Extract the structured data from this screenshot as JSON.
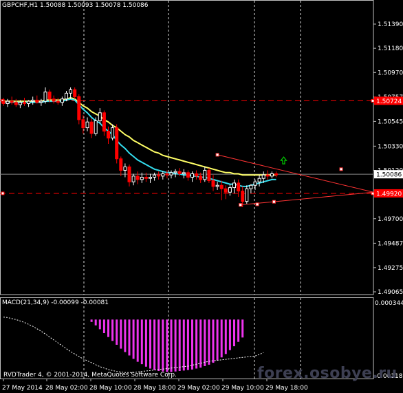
{
  "header": {
    "symbol": "GBPCHF,H1",
    "ohlc": "1.50088 1.50093 1.50078 1.50086"
  },
  "macd_label": "MACD(21,34,9) -0.00099 -0.00081",
  "copyright": "RVDTrader 4, © 2001-2014, MetaQuotes Software Corp.",
  "watermark": "forex.osobye.ru",
  "colors": {
    "background": "#000000",
    "bull_candle": "#ffffff",
    "bear_candle": "#ff0000",
    "ma_slow": "#ffff66",
    "ma_fast": "#33ddee",
    "macd_hist": "#ee33ee",
    "signal_line": "#ffffff",
    "hline": "#ff0000",
    "triangle": "#ff3333",
    "arrow": "#00cc00",
    "grid": "#ffffff"
  },
  "chart_data": {
    "type": "candlestick",
    "price_axis": {
      "ticks": [
        "1.51390",
        "1.51180",
        "1.50970",
        "1.50757",
        "1.50545",
        "1.50330",
        "1.50120",
        "1.49910",
        "1.49700",
        "1.49487",
        "1.49275",
        "1.49065"
      ],
      "current_price": "1.50086",
      "level_high": "1.50724",
      "level_low": "1.49920"
    },
    "time_labels": [
      "27 May 2014",
      "28 May 02:00",
      "28 May 10:00",
      "28 May 18:00",
      "29 May 02:00",
      "29 May 10:00",
      "29 May 18:00"
    ],
    "candles": [
      {
        "o": 1.5072,
        "h": 1.5075,
        "l": 1.5068,
        "c": 1.507
      },
      {
        "o": 1.507,
        "h": 1.5074,
        "l": 1.5067,
        "c": 1.5072
      },
      {
        "o": 1.5072,
        "h": 1.5076,
        "l": 1.5069,
        "c": 1.5071
      },
      {
        "o": 1.5071,
        "h": 1.5074,
        "l": 1.5067,
        "c": 1.5069
      },
      {
        "o": 1.5069,
        "h": 1.5073,
        "l": 1.5066,
        "c": 1.5071
      },
      {
        "o": 1.5071,
        "h": 1.5075,
        "l": 1.5068,
        "c": 1.507
      },
      {
        "o": 1.507,
        "h": 1.5073,
        "l": 1.5067,
        "c": 1.5072
      },
      {
        "o": 1.5072,
        "h": 1.5076,
        "l": 1.5069,
        "c": 1.5073
      },
      {
        "o": 1.5073,
        "h": 1.5077,
        "l": 1.507,
        "c": 1.5071
      },
      {
        "o": 1.5071,
        "h": 1.5074,
        "l": 1.5068,
        "c": 1.5072
      },
      {
        "o": 1.5072,
        "h": 1.5084,
        "l": 1.507,
        "c": 1.508
      },
      {
        "o": 1.508,
        "h": 1.5082,
        "l": 1.5071,
        "c": 1.5074
      },
      {
        "o": 1.5074,
        "h": 1.5077,
        "l": 1.507,
        "c": 1.5072
      },
      {
        "o": 1.5072,
        "h": 1.5075,
        "l": 1.5069,
        "c": 1.5071
      },
      {
        "o": 1.5071,
        "h": 1.5076,
        "l": 1.5068,
        "c": 1.5074
      },
      {
        "o": 1.5074,
        "h": 1.5081,
        "l": 1.5072,
        "c": 1.5079
      },
      {
        "o": 1.5079,
        "h": 1.5084,
        "l": 1.5074,
        "c": 1.5082
      },
      {
        "o": 1.5082,
        "h": 1.5084,
        "l": 1.5074,
        "c": 1.5076
      },
      {
        "o": 1.5076,
        "h": 1.5078,
        "l": 1.5052,
        "c": 1.5056
      },
      {
        "o": 1.5056,
        "h": 1.506,
        "l": 1.5044,
        "c": 1.5049
      },
      {
        "o": 1.5049,
        "h": 1.5058,
        "l": 1.5046,
        "c": 1.5054
      },
      {
        "o": 1.5054,
        "h": 1.5057,
        "l": 1.504,
        "c": 1.5044
      },
      {
        "o": 1.5044,
        "h": 1.5058,
        "l": 1.5042,
        "c": 1.5055
      },
      {
        "o": 1.5055,
        "h": 1.5066,
        "l": 1.5053,
        "c": 1.5062
      },
      {
        "o": 1.5062,
        "h": 1.5064,
        "l": 1.5042,
        "c": 1.5046
      },
      {
        "o": 1.5046,
        "h": 1.505,
        "l": 1.5035,
        "c": 1.504
      },
      {
        "o": 1.504,
        "h": 1.5052,
        "l": 1.5038,
        "c": 1.5049
      },
      {
        "o": 1.5049,
        "h": 1.5052,
        "l": 1.5018,
        "c": 1.5022
      },
      {
        "o": 1.5022,
        "h": 1.5024,
        "l": 1.5007,
        "c": 1.5012
      },
      {
        "o": 1.5012,
        "h": 1.5018,
        "l": 1.5006,
        "c": 1.5015
      },
      {
        "o": 1.5015,
        "h": 1.5017,
        "l": 1.4998,
        "c": 1.5002
      },
      {
        "o": 1.5002,
        "h": 1.5009,
        "l": 1.4999,
        "c": 1.5007
      },
      {
        "o": 1.5007,
        "h": 1.5011,
        "l": 1.5,
        "c": 1.5004
      },
      {
        "o": 1.5004,
        "h": 1.501,
        "l": 1.5001,
        "c": 1.5006
      },
      {
        "o": 1.5006,
        "h": 1.501,
        "l": 1.5002,
        "c": 1.5005
      },
      {
        "o": 1.5005,
        "h": 1.5009,
        "l": 1.5001,
        "c": 1.5006
      },
      {
        "o": 1.5006,
        "h": 1.501,
        "l": 1.5003,
        "c": 1.5008
      },
      {
        "o": 1.5008,
        "h": 1.5011,
        "l": 1.5004,
        "c": 1.5007
      },
      {
        "o": 1.5007,
        "h": 1.5011,
        "l": 1.5004,
        "c": 1.5009
      },
      {
        "o": 1.5009,
        "h": 1.5012,
        "l": 1.5005,
        "c": 1.5008
      },
      {
        "o": 1.5008,
        "h": 1.5012,
        "l": 1.5005,
        "c": 1.501
      },
      {
        "o": 1.501,
        "h": 1.5013,
        "l": 1.5006,
        "c": 1.5011
      },
      {
        "o": 1.5011,
        "h": 1.5014,
        "l": 1.5007,
        "c": 1.5009
      },
      {
        "o": 1.5009,
        "h": 1.5013,
        "l": 1.5005,
        "c": 1.501
      },
      {
        "o": 1.501,
        "h": 1.5012,
        "l": 1.5003,
        "c": 1.5006
      },
      {
        "o": 1.5006,
        "h": 1.5011,
        "l": 1.5002,
        "c": 1.5009
      },
      {
        "o": 1.5009,
        "h": 1.5012,
        "l": 1.5004,
        "c": 1.5007
      },
      {
        "o": 1.5007,
        "h": 1.501,
        "l": 1.5001,
        "c": 1.5004
      },
      {
        "o": 1.5004,
        "h": 1.5015,
        "l": 1.5002,
        "c": 1.5012
      },
      {
        "o": 1.5012,
        "h": 1.5014,
        "l": 1.5001,
        "c": 1.5003
      },
      {
        "o": 1.5003,
        "h": 1.5008,
        "l": 1.4994,
        "c": 1.4998
      },
      {
        "o": 1.4998,
        "h": 1.5002,
        "l": 1.4995,
        "c": 1.4999
      },
      {
        "o": 1.4999,
        "h": 1.5003,
        "l": 1.4986,
        "c": 1.4996
      },
      {
        "o": 1.4996,
        "h": 1.4999,
        "l": 1.4987,
        "c": 1.4993
      },
      {
        "o": 1.4993,
        "h": 1.5,
        "l": 1.499,
        "c": 1.4997
      },
      {
        "o": 1.4997,
        "h": 1.5004,
        "l": 1.4992,
        "c": 1.5001
      },
      {
        "o": 1.5001,
        "h": 1.5004,
        "l": 1.4989,
        "c": 1.4994
      },
      {
        "o": 1.4994,
        "h": 1.4998,
        "l": 1.498,
        "c": 1.4985
      },
      {
        "o": 1.4985,
        "h": 1.4999,
        "l": 1.4983,
        "c": 1.4996
      },
      {
        "o": 1.4996,
        "h": 1.5,
        "l": 1.4992,
        "c": 1.4999
      },
      {
        "o": 1.4999,
        "h": 1.5004,
        "l": 1.4995,
        "c": 1.5002
      },
      {
        "o": 1.5002,
        "h": 1.5008,
        "l": 1.4998,
        "c": 1.5005
      },
      {
        "o": 1.5005,
        "h": 1.5011,
        "l": 1.5001,
        "c": 1.5008
      },
      {
        "o": 1.5008,
        "h": 1.5012,
        "l": 1.5004,
        "c": 1.5007
      },
      {
        "o": 1.5007,
        "h": 1.5011,
        "l": 1.5005,
        "c": 1.5009
      },
      {
        "o": 1.5009,
        "h": 1.5011,
        "l": 1.5006,
        "c": 1.5008
      }
    ],
    "ma_slow": [
      1.5072,
      1.5072,
      1.5072,
      1.5072,
      1.5072,
      1.5072,
      1.5072,
      1.5072,
      1.5072,
      1.5072,
      1.5073,
      1.5073,
      1.5073,
      1.5073,
      1.5073,
      1.5074,
      1.5075,
      1.5074,
      1.5071,
      1.5068,
      1.5066,
      1.5063,
      1.5061,
      1.5059,
      1.5056,
      1.5054,
      1.5051,
      1.5049,
      1.5046,
      1.5043,
      1.5041,
      1.5038,
      1.5036,
      1.5034,
      1.5032,
      1.503,
      1.5028,
      1.5027,
      1.5025,
      1.5024,
      1.5023,
      1.5022,
      1.5021,
      1.502,
      1.5019,
      1.5018,
      1.5017,
      1.5016,
      1.5015,
      1.5014,
      1.5013,
      1.5012,
      1.5011,
      1.501,
      1.501,
      1.5009,
      1.5009,
      1.5008,
      1.5008,
      1.5008,
      1.5008,
      1.5008,
      1.5008,
      1.5008,
      1.5008,
      1.5008
    ],
    "ma_fast": [
      1.5071,
      1.5071,
      1.5071,
      1.5071,
      1.5071,
      1.5071,
      1.5071,
      1.5071,
      1.5071,
      1.5071,
      1.5072,
      1.5072,
      1.5072,
      1.5072,
      1.5072,
      1.5073,
      1.5074,
      1.5073,
      1.5069,
      1.5065,
      1.5062,
      1.5058,
      1.5055,
      1.5053,
      1.5049,
      1.5046,
      1.5043,
      1.5038,
      1.5034,
      1.5031,
      1.5027,
      1.5024,
      1.5021,
      1.5019,
      1.5017,
      1.5015,
      1.5013,
      1.5012,
      1.5011,
      1.501,
      1.501,
      1.5009,
      1.5009,
      1.5008,
      1.5008,
      1.5007,
      1.5007,
      1.5006,
      1.5006,
      1.5005,
      1.5004,
      1.5003,
      1.5002,
      1.5001,
      1.5,
      1.5,
      1.4999,
      1.4998,
      1.4998,
      1.4999,
      1.5,
      1.5001,
      1.5002,
      1.5003,
      1.5004,
      1.5004
    ],
    "macd": {
      "axis_top": "0.000344",
      "axis_bottom": "-0.001187",
      "max": 0.000344,
      "min": -0.001187,
      "hist_start_index": 21,
      "histogram": [
        -5e-05,
        -0.00012,
        -0.0002,
        -0.00028,
        -0.00036,
        -0.00044,
        -0.00052,
        -0.0006,
        -0.00067,
        -0.00074,
        -0.00081,
        -0.00087,
        -0.00092,
        -0.00097,
        -0.00101,
        -0.00104,
        -0.00106,
        -0.00107,
        -0.00108,
        -0.00108,
        -0.00107,
        -0.00106,
        -0.00105,
        -0.00104,
        -0.00103,
        -0.00101,
        -0.00099,
        -0.00096,
        -0.00093,
        -0.00089,
        -0.00084,
        -0.00078,
        -0.00071,
        -0.00063,
        -0.00055,
        -0.00046,
        -0.00037
      ],
      "signal": [
        5e-05,
        4e-05,
        2e-05,
        0.0,
        -3e-05,
        -6e-05,
        -0.0001,
        -0.00014,
        -0.00019,
        -0.00024,
        -0.0003,
        -0.00036,
        -0.00042,
        -0.00048,
        -0.00054,
        -0.0006,
        -0.00066,
        -0.00071,
        -0.00076,
        -0.00081,
        -0.00085,
        -0.00089,
        -0.00093,
        -0.00097,
        -0.001,
        -0.00103,
        -0.00105,
        -0.00107,
        -0.00108,
        -0.00109,
        -0.00109,
        -0.00109,
        -0.00108,
        -0.00107,
        -0.00106,
        -0.00105,
        -0.00104,
        -0.00103,
        -0.00102,
        -0.00101,
        -0.001,
        -0.00099,
        -0.00098,
        -0.00097,
        -0.00096,
        -0.00094,
        -0.00092,
        -0.0009,
        -0.00088,
        -0.00086,
        -0.00085,
        -0.00084,
        -0.00083,
        -0.00082,
        -0.00081,
        -0.0008,
        -0.00079,
        -0.00078,
        -0.00077,
        -0.00076,
        -0.00075,
        -0.00072,
        -0.00068
      ]
    },
    "triangle": [
      {
        "x": 1.5,
        "price": 1.5026
      },
      {
        "x": 44,
        "price": 1.50085
      },
      {
        "x": 28.5,
        "price": 1.49825
      },
      {
        "x": 34.5,
        "price": 1.4984
      }
    ]
  }
}
